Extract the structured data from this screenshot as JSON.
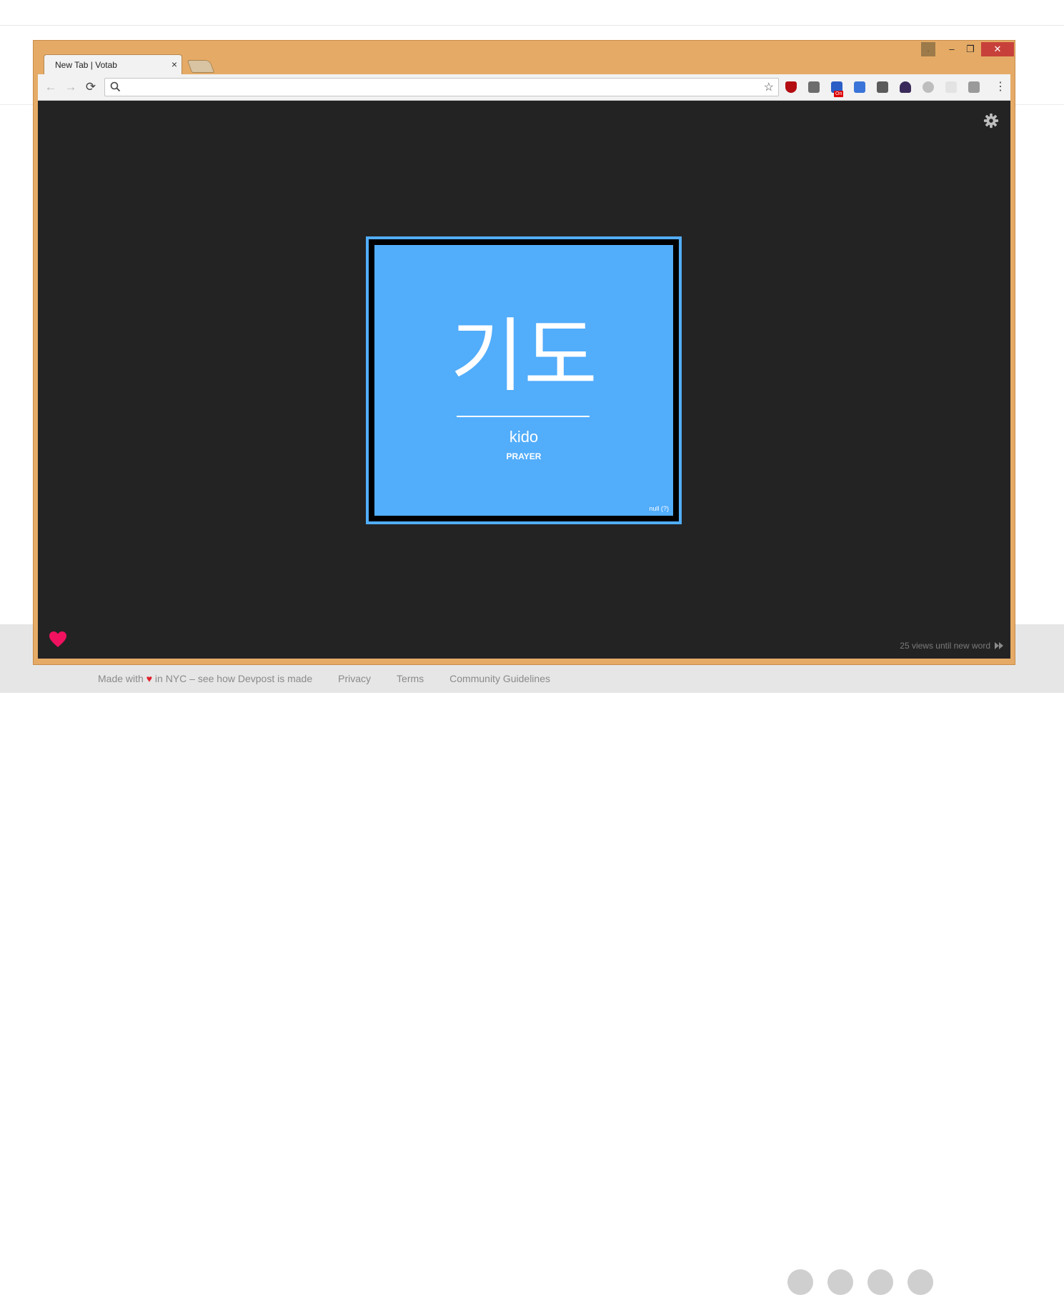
{
  "browser": {
    "tab_title": "New Tab | Votab",
    "tab_close": "×",
    "nav_back": "←",
    "nav_forward": "→",
    "nav_reload": "⟳",
    "omnibox_value": "",
    "star": "☆",
    "menu": "⋮",
    "window_min": "–",
    "window_max": "❐",
    "window_close": "✕",
    "user_badge": ".",
    "extension_badge_text": "On",
    "extensions": [
      {
        "name": "ublock-icon",
        "color": "#b30d12"
      },
      {
        "name": "puzzle-icon",
        "color": "#6d6d6d"
      },
      {
        "name": "chinese-dictionary-icon",
        "color": "#2b5fc6"
      },
      {
        "name": "calendar-icon",
        "color": "#3a74d8"
      },
      {
        "name": "eyes-icon",
        "color": "#5b5b5b"
      },
      {
        "name": "ghost-icon",
        "color": "#3a2a5a"
      },
      {
        "name": "play-icon",
        "color": "#bdbdbd"
      },
      {
        "name": "faded-extension-icon",
        "color": "#e3e3e3"
      },
      {
        "name": "v-icon",
        "color": "#9a9a9a"
      }
    ]
  },
  "page": {
    "word": "기도",
    "romanization": "kido",
    "translation": "PRAYER",
    "null_note": "null (?)",
    "views_note": "25 views until new word",
    "card_color": "#52adfb",
    "background_color": "#232323"
  },
  "footer": {
    "made_with_prefix": "Made with",
    "heart": "♥",
    "made_with_suffix": "in NYC – see how Devpost is made",
    "links": [
      "Privacy",
      "Terms",
      "Community Guidelines"
    ]
  }
}
